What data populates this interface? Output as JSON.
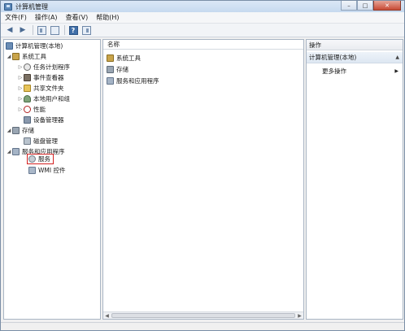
{
  "window": {
    "title": "计算机管理",
    "controls": {
      "minimize": "–",
      "maximize": "□",
      "close": "✕"
    }
  },
  "menu": [
    "文件(F)",
    "操作(A)",
    "查看(V)",
    "帮助(H)"
  ],
  "toolbar": {
    "back_icon": "arrow-left-icon",
    "forward_icon": "arrow-right-icon",
    "help_label": "?"
  },
  "tree": {
    "root": "计算机管理(本地)",
    "system_tools": "系统工具",
    "task_scheduler": "任务计划程序",
    "event_viewer": "事件查看器",
    "shared_folders": "共享文件夹",
    "local_users": "本地用户和组",
    "performance": "性能",
    "device_manager": "设备管理器",
    "storage": "存储",
    "disk_management": "磁盘管理",
    "services_apps": "服务和应用程序",
    "services": "服务",
    "wmi": "WMI 控件"
  },
  "middle": {
    "header": "名称",
    "items": [
      "系统工具",
      "存储",
      "服务和应用程序"
    ]
  },
  "actions": {
    "header": "操作",
    "section": "计算机管理(本地)",
    "more": "更多操作"
  }
}
